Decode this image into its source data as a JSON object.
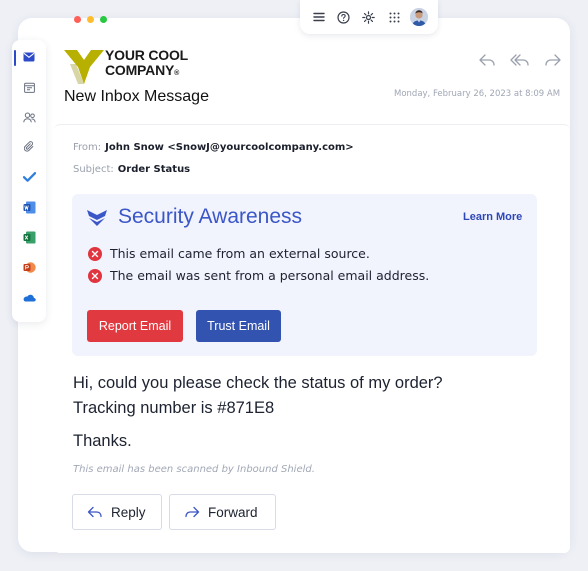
{
  "window": {
    "traffic_lights": [
      "#ff5f57",
      "#febc2e",
      "#28c840"
    ]
  },
  "toolbar": {
    "icons": [
      "menu-icon",
      "help-icon",
      "settings-icon",
      "apps-grid-icon",
      "user-avatar"
    ]
  },
  "sidebar": {
    "items": [
      {
        "icon": "mail-icon",
        "active": true
      },
      {
        "icon": "calendar-icon"
      },
      {
        "icon": "people-icon"
      },
      {
        "icon": "attachment-icon"
      },
      {
        "icon": "todo-check-icon"
      },
      {
        "icon": "word-icon"
      },
      {
        "icon": "excel-icon"
      },
      {
        "icon": "powerpoint-icon"
      },
      {
        "icon": "onedrive-icon"
      }
    ]
  },
  "header": {
    "logo_line1": "YOUR COOL",
    "logo_line2": "COMPANY",
    "logo_mark": "®",
    "title": "New Inbox Message",
    "date": "Monday, February 26, 2023 at 8:09 AM"
  },
  "message": {
    "from_label": "From:",
    "from_value": "John Snow <SnowJ@yourcoolcompany.com>",
    "subject_label": "Subject:",
    "subject_value": "Order Status"
  },
  "security": {
    "title": "Security Awareness",
    "learn_more": "Learn More",
    "warnings": [
      "This email came from an external source.",
      "The email was sent from a personal email address."
    ],
    "report_label": "Report Email",
    "trust_label": "Trust Email"
  },
  "body": {
    "line1": "Hi, could you please check the status of my order?",
    "line2": "Tracking number is #871E8",
    "thanks": "Thanks.",
    "scanned": "This email has been scanned by Inbound Shield."
  },
  "footer": {
    "reply_label": "Reply",
    "forward_label": "Forward"
  },
  "colors": {
    "accent_blue": "#3b56c6",
    "danger_red": "#e03a40",
    "trust_blue": "#3353b0",
    "logo_yellow": "#b8b000"
  }
}
